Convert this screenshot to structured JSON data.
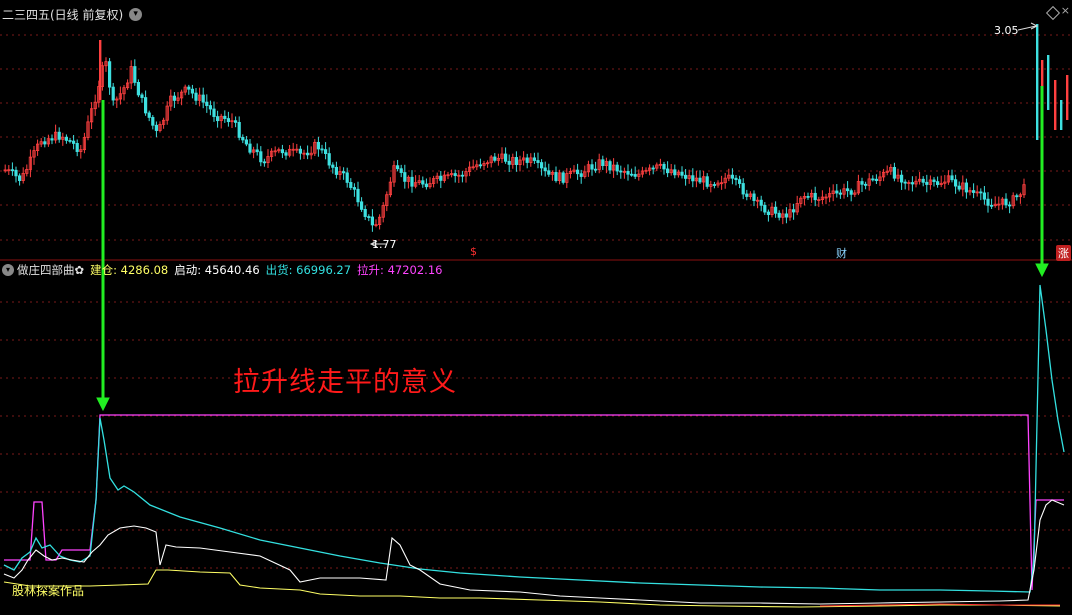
{
  "header": {
    "title": "二三四五(日线 前复权)",
    "dropdown_icon": "chevron-down-icon"
  },
  "price_panel": {
    "high_label": "3.05",
    "low_label": "1.77",
    "markers": {
      "s": "$",
      "cai": "财",
      "zhang": "涨"
    }
  },
  "indicator": {
    "name": "做庄四部曲✿",
    "items": [
      {
        "label": "建仓:",
        "value": "4286.08",
        "color": "#ffff66"
      },
      {
        "label": "启动:",
        "value": "45640.46",
        "color": "#ffffff"
      },
      {
        "label": "出货:",
        "value": "66996.27",
        "color": "#33e0e0"
      },
      {
        "label": "拉升:",
        "value": "47202.16",
        "color": "#ff44ff"
      }
    ]
  },
  "annotation": "拉升线走平的意义",
  "author": "股林探案作品",
  "colors": {
    "up": "#ff4040",
    "down": "#3ee0e0",
    "arrow": "#22ee22",
    "jiancang": "#ffff66",
    "qidong": "#ffffff",
    "chuhuo": "#33e0e0",
    "lasheng": "#ff44ff",
    "divider": "#8b1010"
  }
}
